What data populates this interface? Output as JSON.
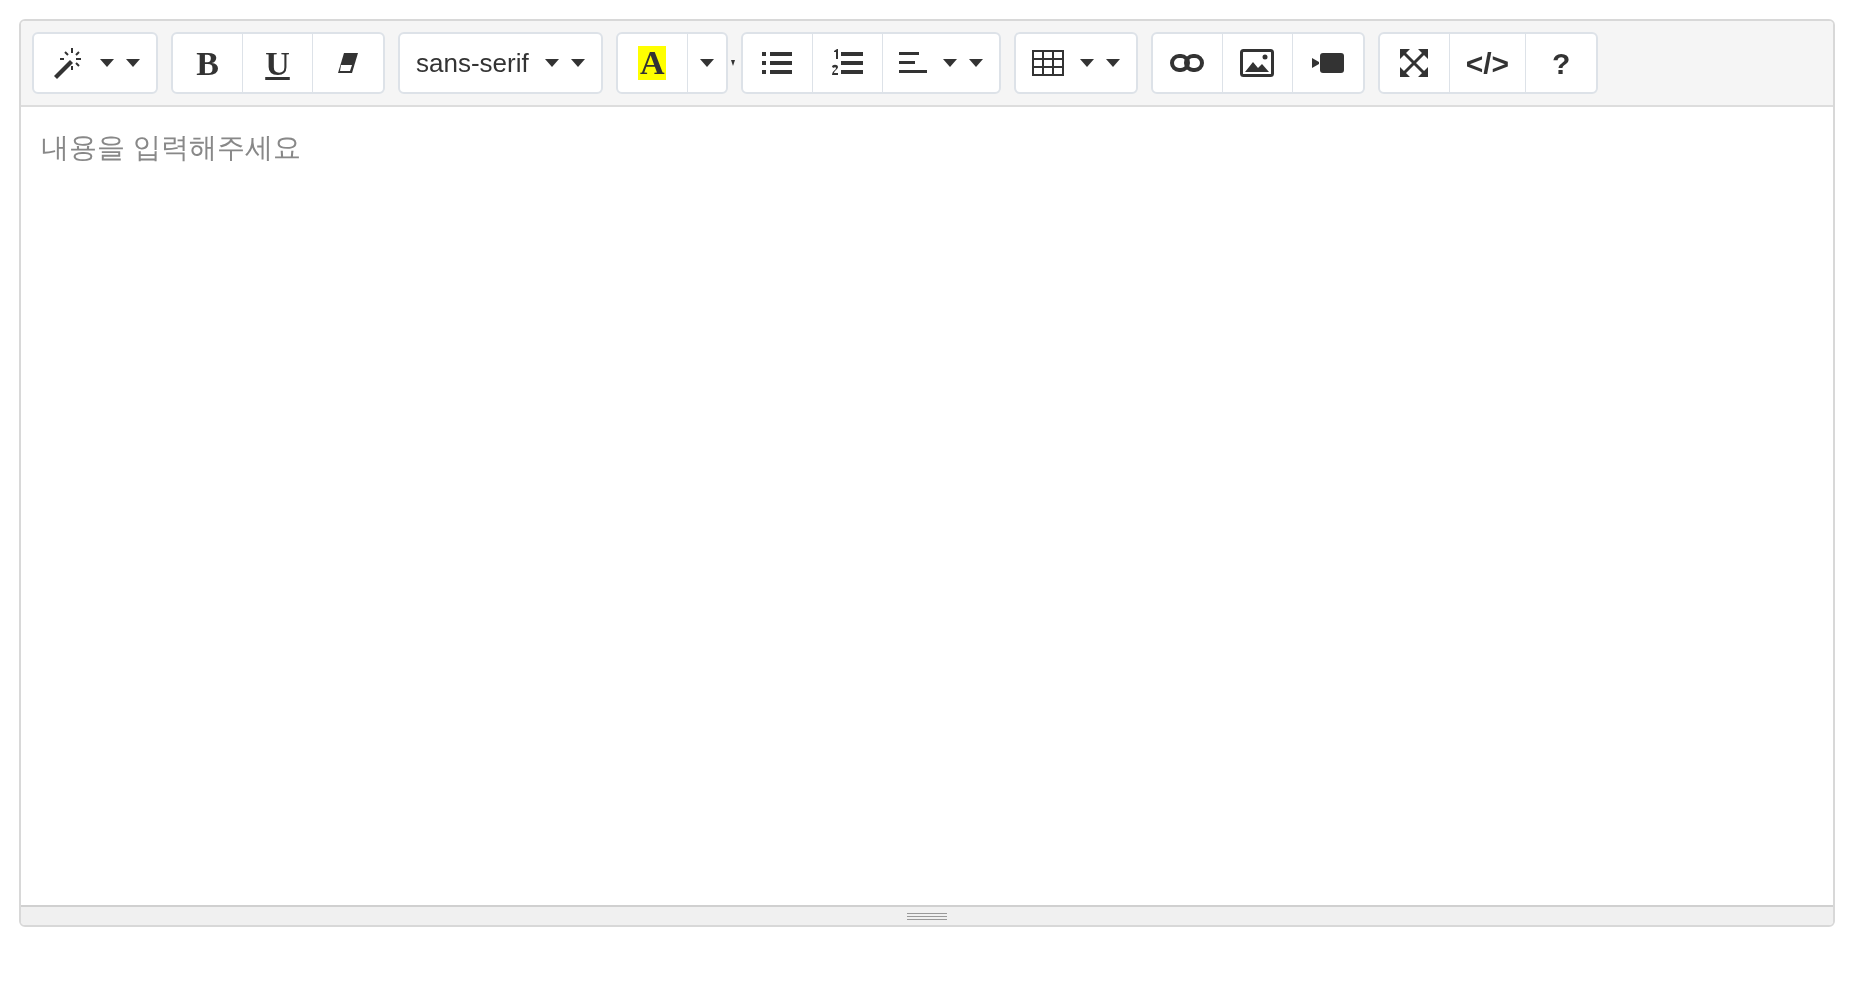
{
  "toolbar": {
    "groups": [
      {
        "buttons": [
          {
            "kind": "magic",
            "caret": true
          }
        ]
      },
      {
        "buttons": [
          {
            "kind": "text",
            "label": "B",
            "caret": false
          },
          {
            "kind": "text",
            "label": "U",
            "caret": false
          },
          {
            "kind": "eraser",
            "caret": false
          }
        ]
      },
      {
        "buttons": [
          {
            "kind": "text",
            "label": "sans-serif",
            "caret": true
          }
        ]
      },
      {
        "buttons": [
          {
            "kind": "text",
            "label": "A",
            "highlight": true,
            "caret": false
          },
          {
            "kind": "caret"
          }
        ],
        "overflow_caret": true
      },
      {
        "buttons": [
          {
            "kind": "ul",
            "caret": false
          },
          {
            "kind": "ol",
            "caret": false
          },
          {
            "kind": "align",
            "caret": true
          }
        ]
      },
      {
        "buttons": [
          {
            "kind": "table",
            "caret": true
          }
        ]
      },
      {
        "buttons": [
          {
            "kind": "link",
            "caret": false
          },
          {
            "kind": "picture",
            "caret": false
          },
          {
            "kind": "video",
            "caret": false
          }
        ]
      },
      {
        "buttons": [
          {
            "kind": "fullscreen",
            "caret": false
          },
          {
            "kind": "text",
            "label": "</>",
            "caret": false
          },
          {
            "kind": "text",
            "label": "?",
            "caret": false
          }
        ]
      }
    ]
  },
  "editor": {
    "placeholder": "내용을 입력해주세요"
  }
}
